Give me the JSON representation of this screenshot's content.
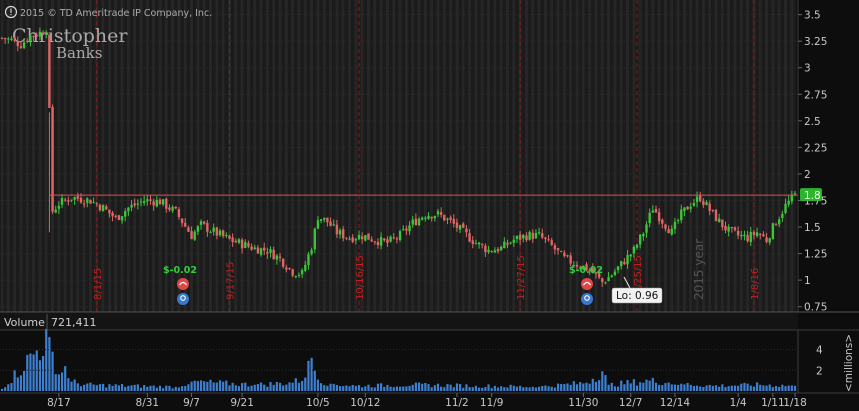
{
  "header": {
    "info_icon": "info-circle-icon",
    "copyright": "2015 © TD Ameritrade IP Company, Inc.",
    "logo_line1": "Christopher",
    "logo_line2": "Banks"
  },
  "volume_panel": {
    "label": "Volume",
    "value": "721,411",
    "unit_label": "<millions>",
    "ticks": [
      "2",
      "4"
    ]
  },
  "price_axis": {
    "ticks": [
      "0.75",
      "1",
      "1.25",
      "1.5",
      "1.75",
      "2",
      "2.25",
      "2.5",
      "2.75",
      "3",
      "3.25",
      "3.5"
    ],
    "current_price_label": "1.8"
  },
  "annotations": {
    "eps_1": "$-0.02",
    "eps_2": "$-0.02",
    "low_label": "Lo: 0.96",
    "year_label": "2015 year",
    "event_labels": [
      "8/1/15",
      "9/17/15",
      "10/16/15",
      "11/27/15",
      "12/25/15",
      "1/8/16"
    ]
  },
  "colors": {
    "up": "#3cc43a",
    "down": "#e06666",
    "volume": "#3d7fd0",
    "price_line": "#e05050",
    "current_price_bg": "#2bb52b",
    "background": "#0d0d0d"
  },
  "chart_data": {
    "type": "candlestick",
    "x_tick_labels": [
      "8/17",
      "8/31",
      "9/7",
      "9/21",
      "10/5",
      "10/12",
      "11/2",
      "11/9",
      "11/30",
      "12/7",
      "12/14",
      "1/4",
      "1/11",
      "1/18"
    ],
    "ylim": [
      0.7,
      3.6
    ],
    "horizontal_line": 1.8,
    "current_price": 1.8,
    "low": 0.96,
    "price_path": [
      [
        0,
        3.28
      ],
      [
        3,
        3.26
      ],
      [
        6,
        3.22
      ],
      [
        9,
        3.3
      ],
      [
        12,
        3.33
      ],
      [
        14,
        3.36
      ],
      [
        15,
        2.58
      ],
      [
        16,
        1.65
      ],
      [
        18,
        1.72
      ],
      [
        22,
        1.78
      ],
      [
        28,
        1.75
      ],
      [
        32,
        1.68
      ],
      [
        36,
        1.58
      ],
      [
        40,
        1.68
      ],
      [
        45,
        1.75
      ],
      [
        50,
        1.74
      ],
      [
        55,
        1.64
      ],
      [
        60,
        1.42
      ],
      [
        63,
        1.52
      ],
      [
        68,
        1.44
      ],
      [
        72,
        1.38
      ],
      [
        76,
        1.34
      ],
      [
        80,
        1.3
      ],
      [
        84,
        1.28
      ],
      [
        88,
        1.2
      ],
      [
        92,
        1.08
      ],
      [
        95,
        1.06
      ],
      [
        98,
        1.32
      ],
      [
        100,
        1.6
      ],
      [
        103,
        1.55
      ],
      [
        106,
        1.45
      ],
      [
        110,
        1.4
      ],
      [
        114,
        1.42
      ],
      [
        118,
        1.38
      ],
      [
        122,
        1.35
      ],
      [
        126,
        1.42
      ],
      [
        130,
        1.54
      ],
      [
        134,
        1.62
      ],
      [
        138,
        1.62
      ],
      [
        142,
        1.55
      ],
      [
        146,
        1.45
      ],
      [
        150,
        1.35
      ],
      [
        154,
        1.28
      ],
      [
        158,
        1.3
      ],
      [
        162,
        1.38
      ],
      [
        166,
        1.42
      ],
      [
        170,
        1.42
      ],
      [
        174,
        1.32
      ],
      [
        178,
        1.2
      ],
      [
        182,
        1.15
      ],
      [
        186,
        1.1
      ],
      [
        190,
        0.98
      ],
      [
        193,
        1.05
      ],
      [
        196,
        1.15
      ],
      [
        200,
        1.28
      ],
      [
        203,
        1.45
      ],
      [
        206,
        1.68
      ],
      [
        209,
        1.56
      ],
      [
        212,
        1.45
      ],
      [
        215,
        1.62
      ],
      [
        218,
        1.72
      ],
      [
        221,
        1.78
      ],
      [
        224,
        1.66
      ],
      [
        227,
        1.55
      ],
      [
        230,
        1.46
      ],
      [
        233,
        1.42
      ],
      [
        236,
        1.4
      ],
      [
        239,
        1.45
      ],
      [
        242,
        1.38
      ],
      [
        245,
        1.55
      ],
      [
        248,
        1.7
      ],
      [
        251,
        1.8
      ]
    ],
    "volume_millions": [
      [
        0,
        0.2
      ],
      [
        15,
        5.2
      ],
      [
        16,
        3.8
      ],
      [
        18,
        1.6
      ],
      [
        20,
        2.4
      ],
      [
        22,
        0.9
      ],
      [
        26,
        0.6
      ],
      [
        40,
        0.5
      ],
      [
        55,
        0.4
      ],
      [
        60,
        0.9
      ],
      [
        80,
        0.6
      ],
      [
        92,
        0.8
      ],
      [
        96,
        1.3
      ],
      [
        98,
        3.2
      ],
      [
        100,
        1.1
      ],
      [
        104,
        0.7
      ],
      [
        112,
        0.5
      ],
      [
        130,
        0.6
      ],
      [
        150,
        0.5
      ],
      [
        170,
        0.4
      ],
      [
        185,
        0.8
      ],
      [
        190,
        1.9
      ],
      [
        192,
        0.6
      ],
      [
        205,
        1.0
      ],
      [
        215,
        0.7
      ],
      [
        225,
        0.5
      ],
      [
        240,
        0.6
      ],
      [
        251,
        0.5
      ]
    ],
    "volume_ylim": [
      0,
      5.5
    ]
  }
}
